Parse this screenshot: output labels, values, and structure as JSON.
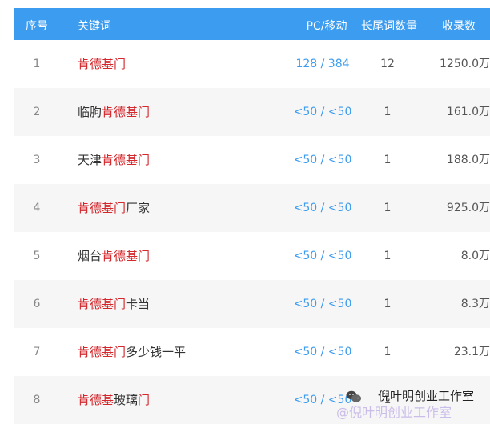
{
  "header": {
    "idx": "序号",
    "keyword": "关键词",
    "pc_mobile": "PC/移动",
    "long_tail": "长尾词数量",
    "indexed": "收录数"
  },
  "rows": [
    {
      "idx": "1",
      "kw_pre": "",
      "kw_hl": "肯德基门",
      "kw_post": "",
      "pc": "128 / 384",
      "tail": "12",
      "inc": "1250.0万"
    },
    {
      "idx": "2",
      "kw_pre": "临朐",
      "kw_hl": "肯德基门",
      "kw_post": "",
      "pc": "<50 / <50",
      "tail": "1",
      "inc": "161.0万"
    },
    {
      "idx": "3",
      "kw_pre": "天津",
      "kw_hl": "肯德基门",
      "kw_post": "",
      "pc": "<50 / <50",
      "tail": "1",
      "inc": "188.0万"
    },
    {
      "idx": "4",
      "kw_pre": "",
      "kw_hl": "肯德基门",
      "kw_post": "厂家",
      "pc": "<50 / <50",
      "tail": "1",
      "inc": "925.0万"
    },
    {
      "idx": "5",
      "kw_pre": "烟台",
      "kw_hl": "肯德基门",
      "kw_post": "",
      "pc": "<50 / <50",
      "tail": "1",
      "inc": "8.0万"
    },
    {
      "idx": "6",
      "kw_pre": "",
      "kw_hl": "肯德基门",
      "kw_post": "卡当",
      "pc": "<50 / <50",
      "tail": "1",
      "inc": "8.3万"
    },
    {
      "idx": "7",
      "kw_pre": "",
      "kw_hl": "肯德基门",
      "kw_post": "多少钱一平",
      "pc": "<50 / <50",
      "tail": "1",
      "inc": "23.1万"
    },
    {
      "idx": "8",
      "kw_pre": "",
      "kw_hl": "肯德基",
      "kw_post": "玻璃",
      "kw_hl2": "门",
      "pc": "<50 / <50",
      "tail": "1",
      "inc": ""
    }
  ],
  "watermark": {
    "line1": "倪叶明创业工作室",
    "line2": "@倪叶明创业工作室",
    "icon": "wechat-icon"
  },
  "colors": {
    "header_bg": "#3c9cf0",
    "highlight": "#d4282d",
    "link": "#3c9cf0"
  }
}
